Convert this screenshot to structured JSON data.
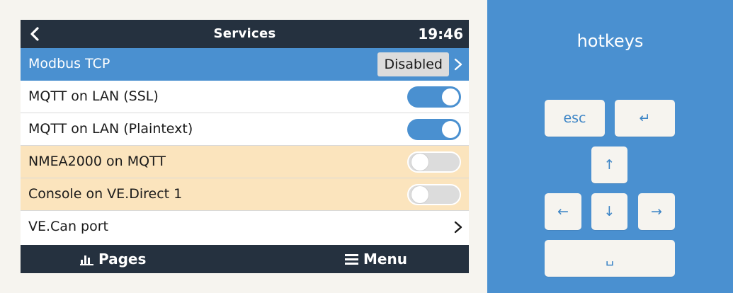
{
  "screen": {
    "title": "Services",
    "clock": "19:46",
    "rows": [
      {
        "label": "Modbus TCP",
        "value": "Disabled"
      },
      {
        "label": "MQTT on LAN (SSL)",
        "toggle": "on"
      },
      {
        "label": "MQTT on LAN (Plaintext)",
        "toggle": "on"
      },
      {
        "label": "NMEA2000 on MQTT",
        "toggle": "off"
      },
      {
        "label": "Console on VE.Direct 1",
        "toggle": "off"
      },
      {
        "label": "VE.Can port"
      }
    ],
    "bottom": {
      "pages_label": "Pages",
      "menu_label": "Menu"
    }
  },
  "hotkeys": {
    "title": "hotkeys",
    "esc": "esc",
    "enter": "↵",
    "up": "↑",
    "left": "←",
    "down": "↓",
    "right": "→",
    "space": "␣"
  },
  "colors": {
    "bar": "#25313f",
    "accent": "#4a90d0",
    "warning_row": "#fbe4bd",
    "background": "#f6f4ef"
  }
}
